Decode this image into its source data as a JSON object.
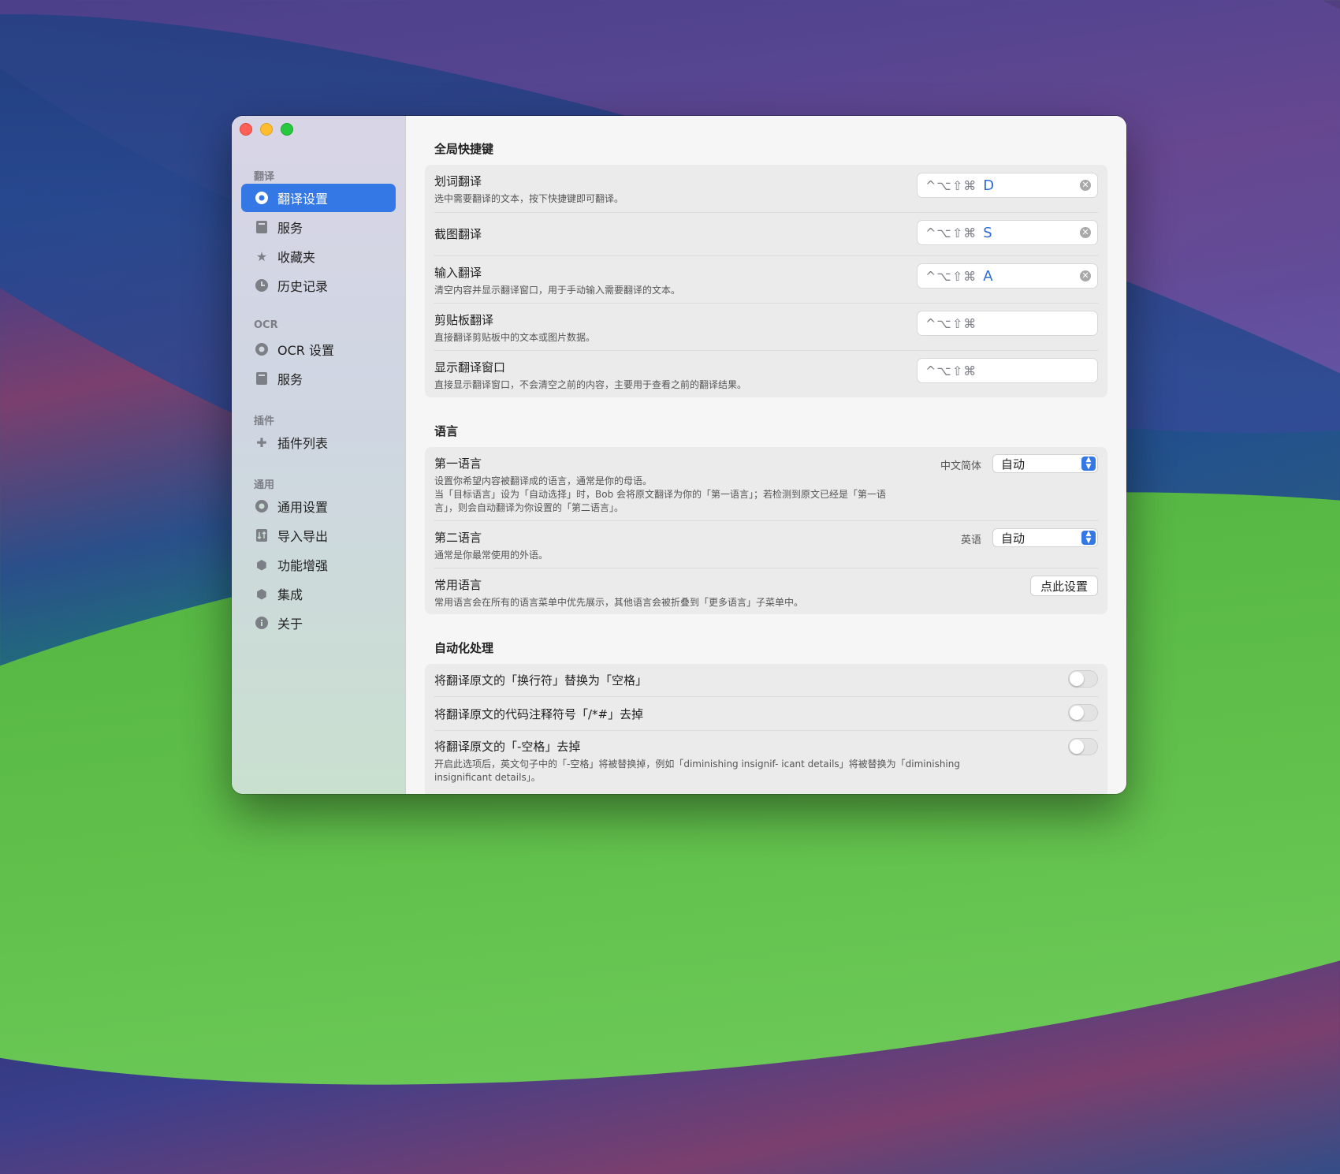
{
  "sidebar": {
    "sections": [
      {
        "label": "翻译",
        "items": [
          {
            "label": "翻译设置",
            "icon": "gear-icon",
            "active": true
          },
          {
            "label": "服务",
            "icon": "book-icon"
          },
          {
            "label": "收藏夹",
            "icon": "star-icon"
          },
          {
            "label": "历史记录",
            "icon": "clock-icon"
          }
        ]
      },
      {
        "label": "OCR",
        "items": [
          {
            "label": "OCR 设置",
            "icon": "gear-icon"
          },
          {
            "label": "服务",
            "icon": "book-icon"
          }
        ]
      },
      {
        "label": "插件",
        "items": [
          {
            "label": "插件列表",
            "icon": "puzzle-icon"
          }
        ]
      },
      {
        "label": "通用",
        "items": [
          {
            "label": "通用设置",
            "icon": "gear-icon"
          },
          {
            "label": "导入导出",
            "icon": "import-export-icon"
          },
          {
            "label": "功能增强",
            "icon": "hexagon-icon"
          },
          {
            "label": "集成",
            "icon": "cube-icon"
          },
          {
            "label": "关于",
            "icon": "info-icon"
          }
        ]
      }
    ]
  },
  "shortcuts": {
    "title": "全局快捷键",
    "modifiers": "^⌥⇧⌘",
    "rows": [
      {
        "title": "划词翻译",
        "desc": "选中需要翻译的文本，按下快捷键即可翻译。",
        "key": "D"
      },
      {
        "title": "截图翻译",
        "desc": "",
        "key": "S"
      },
      {
        "title": "输入翻译",
        "desc": "清空内容并显示翻译窗口，用于手动输入需要翻译的文本。",
        "key": "A"
      },
      {
        "title": "剪贴板翻译",
        "desc": "直接翻译剪贴板中的文本或图片数据。",
        "key": ""
      },
      {
        "title": "显示翻译窗口",
        "desc": "直接显示翻译窗口，不会清空之前的内容，主要用于查看之前的翻译结果。",
        "key": ""
      }
    ]
  },
  "language": {
    "title": "语言",
    "first": {
      "title": "第一语言",
      "desc1": "设置你希望内容被翻译成的语言，通常是你的母语。",
      "desc2": "当「目标语言」设为「自动选择」时，Bob 会将原文翻译为你的「第一语言」；若检测到原文已经是「第一语",
      "desc3": "言」，则会自动翻译为你设置的「第二语言」。",
      "hint": "中文简体",
      "value": "自动"
    },
    "second": {
      "title": "第二语言",
      "desc": "通常是你最常使用的外语。",
      "hint": "英语",
      "value": "自动"
    },
    "common": {
      "title": "常用语言",
      "desc": "常用语言会在所有的语言菜单中优先展示，其他语言会被折叠到「更多语言」子菜单中。",
      "button": "点此设置"
    }
  },
  "automation": {
    "title": "自动化处理",
    "rows": [
      {
        "title": "将翻译原文的「换行符」替换为「空格」",
        "on": false
      },
      {
        "title": "将翻译原文的代码注释符号「/*#」去掉",
        "on": false
      },
      {
        "title": "将翻译原文的「-空格」去掉",
        "desc1": "开启此选项后，英文句子中的「-空格」将被替换掉，例如「diminishing insignif- icant details」将被替换为「diminishing",
        "desc2": "insignificant details」。",
        "on": false
      }
    ]
  }
}
